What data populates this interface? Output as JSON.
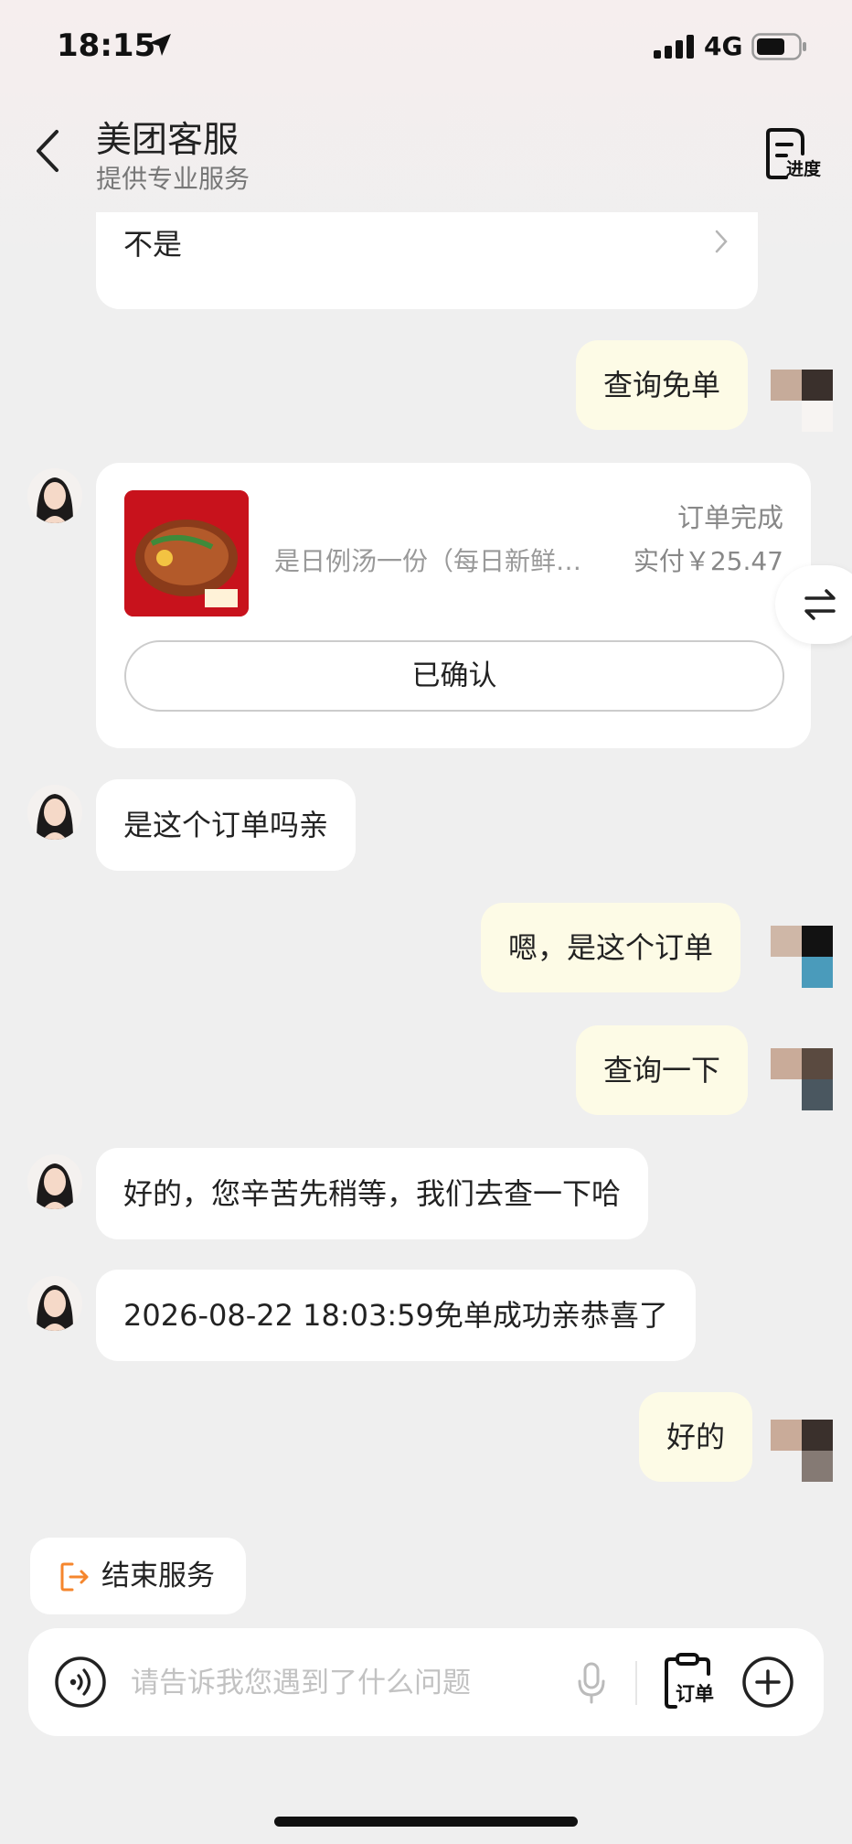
{
  "status_bar": {
    "time": "18:15",
    "network": "4G"
  },
  "header": {
    "title": "美团客服",
    "subtitle": "提供专业服务",
    "progress_label": "进度"
  },
  "messages": {
    "option_no": "不是",
    "user_query_free": "查询免单",
    "order_card": {
      "status": "订单完成",
      "item_name": "是日例汤一份（每日新鲜…",
      "price": "实付￥25.47",
      "confirm_label": "已确认"
    },
    "agent_is_this_order": "是这个订单吗亲",
    "user_yes_order": "嗯，是这个订单",
    "user_check": "查询一下",
    "agent_wait": "好的，您辛苦先稍等，我们去查一下哈",
    "agent_result": "2026-08-22 18:03:59免单成功亲恭喜了",
    "user_ok": "好的"
  },
  "end_service_label": "结束服务",
  "input": {
    "placeholder": "请告诉我您遇到了什么问题",
    "order_label": "订单"
  },
  "colors": {
    "user_bubble": "#fdfbe6",
    "agent_bubble": "#ffffff",
    "accent_orange": "#f5862d"
  }
}
